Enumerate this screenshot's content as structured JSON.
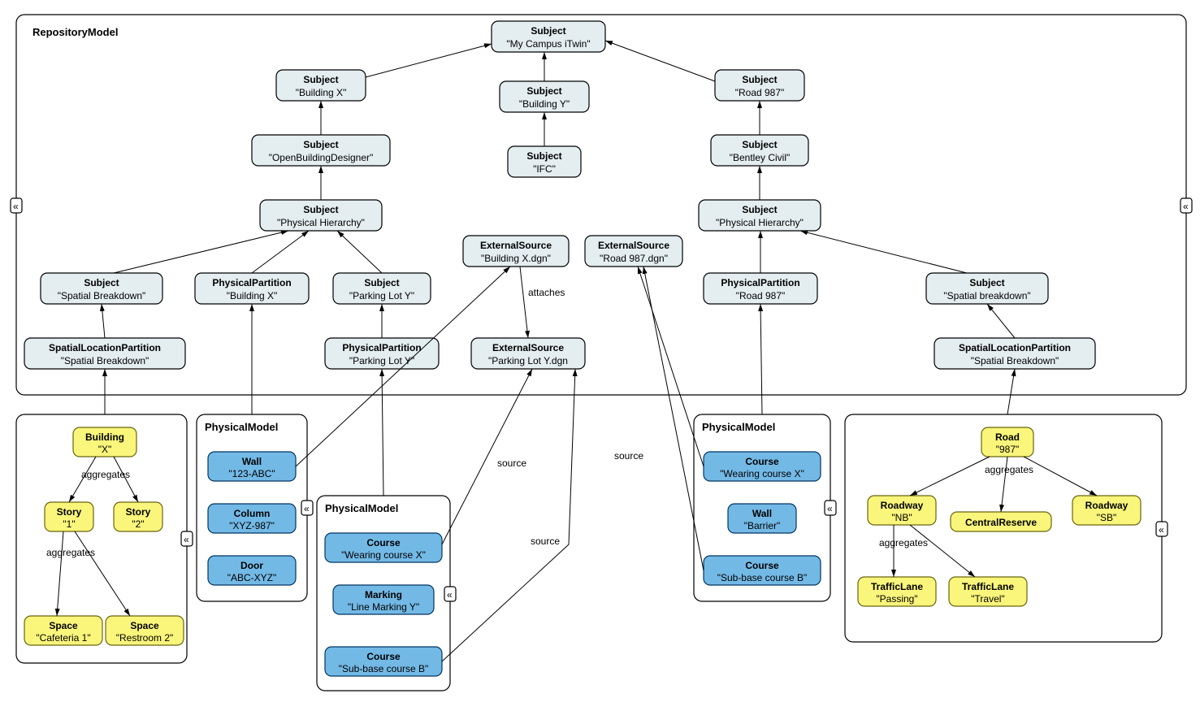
{
  "diagram": {
    "containerTitle": "RepositoryModel",
    "nodes": {
      "root": {
        "type": "Subject",
        "value": "\"My Campus iTwin\""
      },
      "bldgX": {
        "type": "Subject",
        "value": "\"Building X\""
      },
      "bldgY": {
        "type": "Subject",
        "value": "\"Building Y\""
      },
      "road987": {
        "type": "Subject",
        "value": "\"Road 987\""
      },
      "obd": {
        "type": "Subject",
        "value": "\"OpenBuildingDesigner\""
      },
      "ifc": {
        "type": "Subject",
        "value": "\"IFC\""
      },
      "bentley": {
        "type": "Subject",
        "value": "\"Bentley Civil\""
      },
      "physL": {
        "type": "Subject",
        "value": "\"Physical Hierarchy\""
      },
      "physR": {
        "type": "Subject",
        "value": "\"Physical Hierarchy\""
      },
      "spBrkL": {
        "type": "Subject",
        "value": "\"Spatial Breakdown\""
      },
      "ppBX": {
        "type": "PhysicalPartition",
        "value": "\"Building X\""
      },
      "plotY": {
        "type": "Subject",
        "value": "\"Parking Lot Y\""
      },
      "exBX": {
        "type": "ExternalSource",
        "value": "\"Building X.dgn\""
      },
      "exR987": {
        "type": "ExternalSource",
        "value": "\"Road 987.dgn\""
      },
      "ppR987": {
        "type": "PhysicalPartition",
        "value": "\"Road 987\""
      },
      "spBrkR": {
        "type": "Subject",
        "value": "\"Spatial breakdown\""
      },
      "slpL": {
        "type": "SpatialLocationPartition",
        "value": "\"Spatial Breakdown\""
      },
      "ppPLY": {
        "type": "PhysicalPartition",
        "value": "\"Parking Lot Y\""
      },
      "exPLY": {
        "type": "ExternalSource",
        "value": "\"Parking Lot Y.dgn"
      },
      "slpR": {
        "type": "SpatialLocationPartition",
        "value": "\"Spatial Breakdown\""
      },
      "pmBX_title": {
        "type": "PhysicalModel",
        "value": ""
      },
      "wall123": {
        "type": "Wall",
        "value": "\"123-ABC\""
      },
      "colXYZ": {
        "type": "Column",
        "value": "\"XYZ-987\""
      },
      "doorABC": {
        "type": "Door",
        "value": "\"ABC-XYZ\""
      },
      "pmPLY_title": {
        "type": "PhysicalModel",
        "value": ""
      },
      "courseWX": {
        "type": "Course",
        "value": "\"Wearing course X\""
      },
      "markLY": {
        "type": "Marking",
        "value": "\"Line Marking Y\""
      },
      "courseSB": {
        "type": "Course",
        "value": "\"Sub-base course B\""
      },
      "pmR987_title": {
        "type": "PhysicalModel",
        "value": ""
      },
      "courseWX2": {
        "type": "Course",
        "value": "\"Wearing course X\""
      },
      "wallBar": {
        "type": "Wall",
        "value": "\"Barrier\""
      },
      "courseSB2": {
        "type": "Course",
        "value": "\"Sub-base course B\""
      },
      "building": {
        "type": "Building",
        "value": "\"X\""
      },
      "story1": {
        "type": "Story",
        "value": "\"1\""
      },
      "story2": {
        "type": "Story",
        "value": "\"2\""
      },
      "spaceCaf": {
        "type": "Space",
        "value": "\"Cafeteria 1\""
      },
      "spaceRst": {
        "type": "Space",
        "value": "\"Restroom 2\""
      },
      "road": {
        "type": "Road",
        "value": "\"987\""
      },
      "rwNB": {
        "type": "Roadway",
        "value": "\"NB\""
      },
      "rwSB": {
        "type": "Roadway",
        "value": "\"SB\""
      },
      "central": {
        "type": "CentralReserve",
        "value": ""
      },
      "tlPass": {
        "type": "TrafficLane",
        "value": "\"Passing\""
      },
      "tlTrav": {
        "type": "TrafficLane",
        "value": "\"Travel\""
      }
    },
    "edgeLabels": {
      "attaches": "attaches",
      "source": "source",
      "aggregates": "aggregates"
    }
  }
}
